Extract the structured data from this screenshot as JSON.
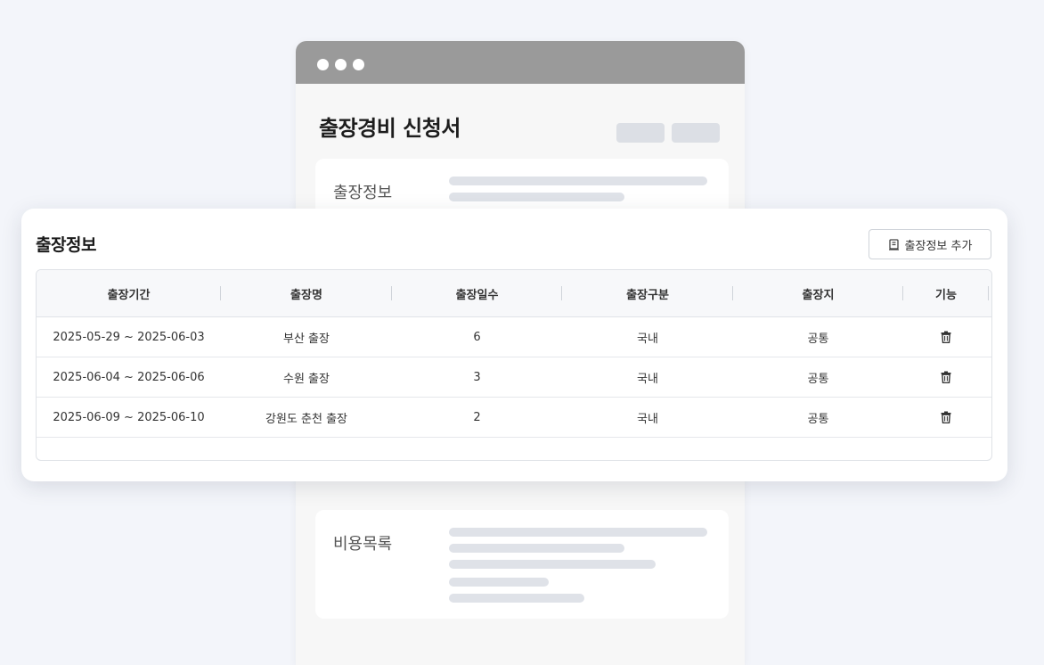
{
  "window": {
    "title": "출장경비 신청서",
    "sections": [
      {
        "label": "출장정보"
      },
      {
        "label": "비용목록"
      }
    ]
  },
  "panel": {
    "title": "출장정보",
    "add_button": {
      "label": "출장정보 추가",
      "icon": "document-icon"
    },
    "columns": [
      "출장기간",
      "출장명",
      "출장일수",
      "출장구분",
      "출장지",
      "기능"
    ],
    "rows": [
      {
        "period": "2025-05-29 ~ 2025-06-03",
        "name": "부산 출장",
        "days": "6",
        "type": "국내",
        "place": "공통"
      },
      {
        "period": "2025-06-04 ~ 2025-06-06",
        "name": "수원 출장",
        "days": "3",
        "type": "국내",
        "place": "공통"
      },
      {
        "period": "2025-06-09 ~ 2025-06-10",
        "name": "강원도 춘천 출장",
        "days": "2",
        "type": "국내",
        "place": "공통"
      }
    ],
    "row_action_icon": "trash-icon"
  }
}
